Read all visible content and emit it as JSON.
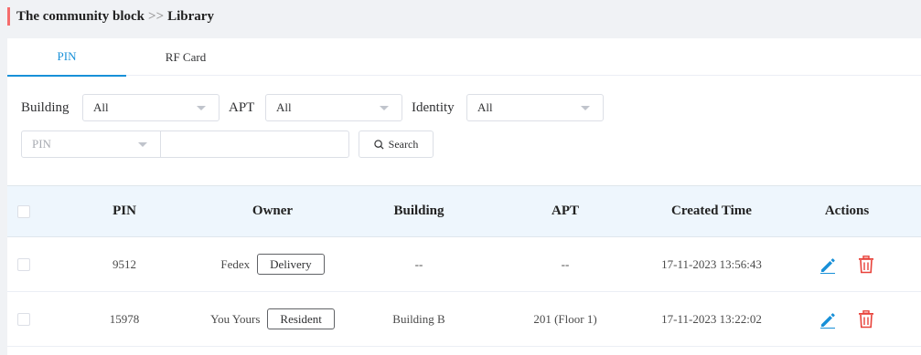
{
  "breadcrumb": {
    "root": "The community block",
    "separator": ">>",
    "current": "Library"
  },
  "tabs": [
    {
      "label": "PIN",
      "active": true
    },
    {
      "label": "RF Card",
      "active": false
    }
  ],
  "filters": {
    "building_label": "Building",
    "building_value": "All",
    "apt_label": "APT",
    "apt_value": "All",
    "identity_label": "Identity",
    "identity_value": "All",
    "search_type_value": "PIN",
    "search_input_value": "",
    "search_button_label": "Search"
  },
  "table": {
    "columns": [
      "PIN",
      "Owner",
      "Building",
      "APT",
      "Created Time",
      "Actions"
    ],
    "rows": [
      {
        "pin": "9512",
        "owner": "Fedex",
        "tag": "Delivery",
        "building": "--",
        "apt": "--",
        "created": "17-11-2023 13:56:43"
      },
      {
        "pin": "15978",
        "owner": "You Yours",
        "tag": "Resident",
        "building": "Building B",
        "apt": "201 (Floor 1)",
        "created": "17-11-2023 13:22:02"
      }
    ]
  },
  "colors": {
    "accent": "#1890d8",
    "danger": "#e8423a",
    "breadcrumb_bar": "#f56c6c",
    "header_bg": "#eef6fd"
  },
  "icons": {
    "edit": "pencil-icon",
    "delete": "trash-icon",
    "search": "magnifier-icon",
    "dropdown": "caret-down-icon"
  }
}
